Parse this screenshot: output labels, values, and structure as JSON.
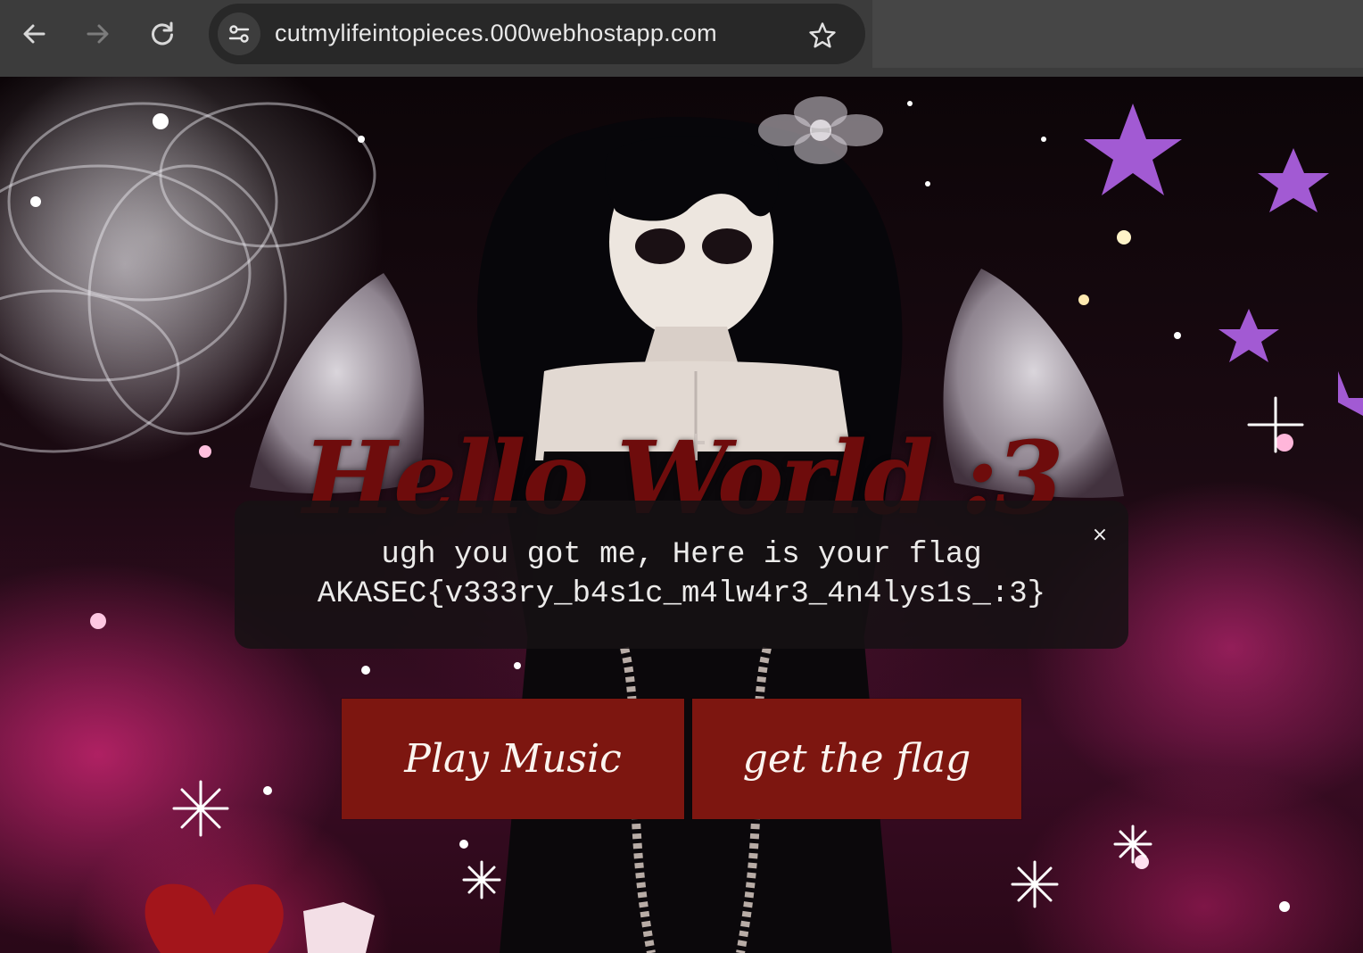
{
  "browser": {
    "url": "cutmylifeintopieces.000webhostapp.com",
    "icons": {
      "back": "arrow-left-icon",
      "forward": "arrow-right-icon",
      "reload": "reload-icon",
      "site_info": "tune-icon",
      "bookmark": "star-icon"
    }
  },
  "page": {
    "heading": "Hello World :3",
    "popup": {
      "line1": "ugh you got me, Here is your flag",
      "line2": "AKASEC{v333ry_b4s1c_m4lw4r3_4n4lys1s_:3}",
      "close_glyph": "×"
    },
    "buttons": {
      "play_music": "Play Music",
      "get_flag": "get the flag"
    }
  },
  "colors": {
    "button_bg": "#7d1610",
    "heading": "#6e0c0c",
    "popup_bg": "#161214"
  }
}
